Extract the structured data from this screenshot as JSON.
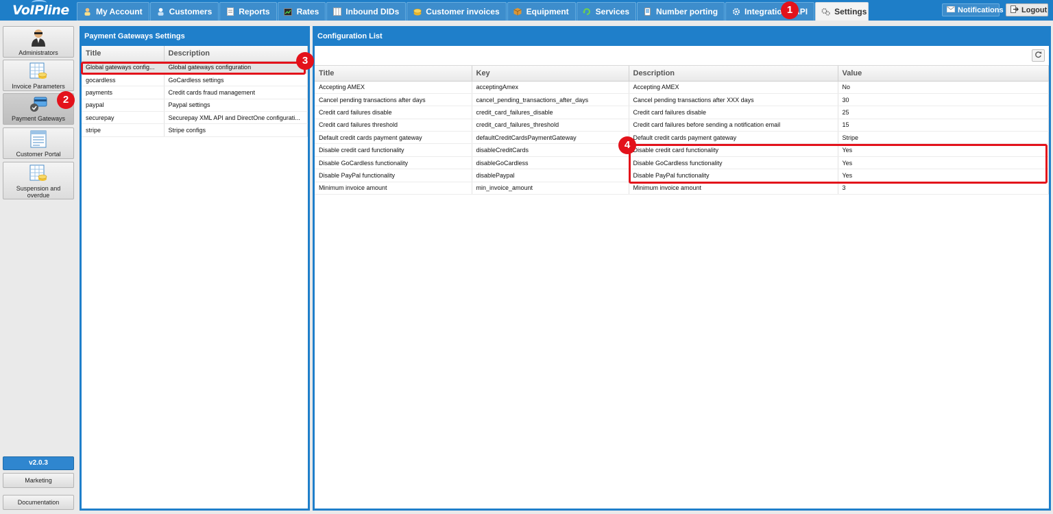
{
  "brand": {
    "logo_text": "VoIPline"
  },
  "nav": {
    "tabs": [
      {
        "label": "My Account",
        "icon": "user-icon"
      },
      {
        "label": "Customers",
        "icon": "customers-icon"
      },
      {
        "label": "Reports",
        "icon": "reports-icon"
      },
      {
        "label": "Rates",
        "icon": "rates-icon"
      },
      {
        "label": "Inbound DIDs",
        "icon": "dids-icon"
      },
      {
        "label": "Customer invoices",
        "icon": "coins-icon"
      },
      {
        "label": "Equipment",
        "icon": "box-icon"
      },
      {
        "label": "Services",
        "icon": "services-icon"
      },
      {
        "label": "Number porting",
        "icon": "phone-icon"
      },
      {
        "label": "Integrations/API",
        "icon": "gear-icon"
      },
      {
        "label": "Settings",
        "icon": "settings-icon"
      }
    ],
    "notifications_label": "Notifications",
    "logout_label": "Logout"
  },
  "sidebar": {
    "items": [
      {
        "label": "Administrators",
        "icon": "administrator-icon"
      },
      {
        "label": "Invoice Parameters",
        "icon": "invoice-icon"
      },
      {
        "label": "Payment Gateways",
        "icon": "payment-gateway-icon"
      },
      {
        "label": "Customer Portal",
        "icon": "portal-icon"
      },
      {
        "label": "Suspension and overdue",
        "icon": "suspension-icon"
      }
    ],
    "version": "v2.0.3",
    "marketing_label": "Marketing",
    "documentation_label": "Documentation"
  },
  "gateways_panel": {
    "title": "Payment Gateways Settings",
    "columns": [
      "Title",
      "Description"
    ],
    "rows": [
      {
        "title": "Global gateways config...",
        "description": "Global gateways configuration"
      },
      {
        "title": "gocardless",
        "description": "GoCardless settings"
      },
      {
        "title": "payments",
        "description": "Credit cards fraud management"
      },
      {
        "title": "paypal",
        "description": "Paypal settings"
      },
      {
        "title": "securepay",
        "description": "Securepay XML API and DirectOne configurati..."
      },
      {
        "title": "stripe",
        "description": "Stripe configs"
      }
    ]
  },
  "config_panel": {
    "title": "Configuration List",
    "columns": [
      "Title",
      "Key",
      "Description",
      "Value"
    ],
    "rows": [
      {
        "title": "Accepting AMEX",
        "key": "acceptingAmex",
        "description": "Accepting AMEX",
        "value": "No"
      },
      {
        "title": "Cancel pending transactions after days",
        "key": "cancel_pending_transactions_after_days",
        "description": "Cancel pending transactions after XXX days",
        "value": "30"
      },
      {
        "title": "Credit card failures disable",
        "key": "credit_card_failures_disable",
        "description": "Credit card failures disable",
        "value": "25"
      },
      {
        "title": "Credit card failures threshold",
        "key": "credit_card_failures_threshold",
        "description": "Credit card failures before sending a notification email",
        "value": "15"
      },
      {
        "title": "Default credit cards payment gateway",
        "key": "defaultCreditCardsPaymentGateway",
        "description": "Default credit cards payment gateway",
        "value": "Stripe"
      },
      {
        "title": "Disable credit card functionality",
        "key": "disableCreditCards",
        "description": "Disable credit card functionality",
        "value": "Yes"
      },
      {
        "title": "Disable GoCardless functionality",
        "key": "disableGoCardless",
        "description": "Disable GoCardless functionality",
        "value": "Yes"
      },
      {
        "title": "Disable PayPal functionality",
        "key": "disablePaypal",
        "description": "Disable PayPal functionality",
        "value": "Yes"
      },
      {
        "title": "Minimum invoice amount",
        "key": "min_invoice_amount",
        "description": "Minimum invoice amount",
        "value": "3"
      }
    ]
  },
  "annotations": [
    "1",
    "2",
    "3",
    "4"
  ],
  "colors": {
    "primary": "#1f7fca",
    "annotation": "#e3121b"
  }
}
